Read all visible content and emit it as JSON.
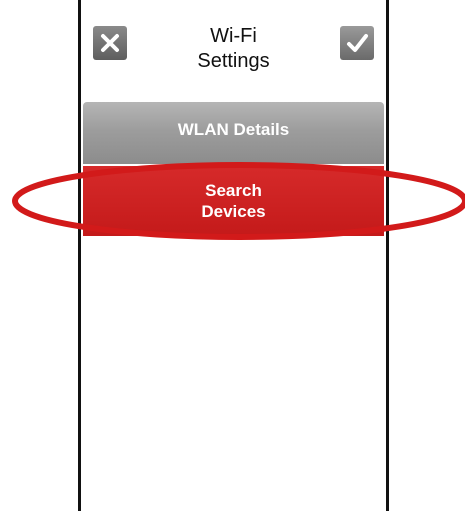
{
  "header": {
    "title_line1": "Wi-Fi",
    "title_line2": "Settings",
    "cancel_icon": "close-icon",
    "confirm_icon": "checkmark-icon"
  },
  "menu": {
    "wlan_details_label": "WLAN Details",
    "search_devices_line1": "Search",
    "search_devices_line2": "Devices"
  },
  "colors": {
    "accent_red": "#c41a1a",
    "highlight_ring": "#d21a1a",
    "button_gray": "#9d9d9d"
  }
}
